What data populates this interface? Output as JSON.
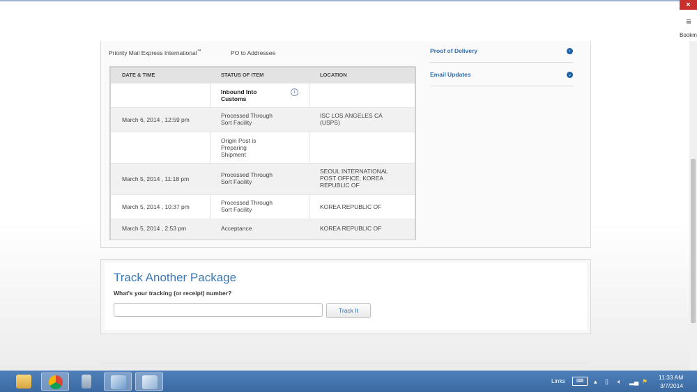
{
  "browser": {
    "close_label": "×",
    "menu_label": "≡",
    "bookmarks_label": "Bookmarks"
  },
  "shipment": {
    "service": "Priority Mail Express International",
    "service_mark": "™",
    "delivery_option": "PO to Addressee"
  },
  "table": {
    "headers": [
      "DATE & TIME",
      "STATUS OF ITEM",
      "LOCATION"
    ],
    "rows": [
      {
        "date": "",
        "status_line1": "Inbound Into",
        "status_line2": "Customs",
        "status_line3": "",
        "location_line1": "",
        "location_line2": "",
        "location_line3": ""
      },
      {
        "date": "March 6, 2014 , 12:59 pm",
        "status_line1": "Processed Through",
        "status_line2": "Sort Facility",
        "status_line3": "",
        "location_line1": "ISC LOS ANGELES CA",
        "location_line2": "(USPS)",
        "location_line3": ""
      },
      {
        "date": "",
        "status_line1": "Origin Post is",
        "status_line2": "Preparing",
        "status_line3": "Shipment",
        "location_line1": "",
        "location_line2": "",
        "location_line3": ""
      },
      {
        "date": "March 5, 2014 , 11:18 pm",
        "status_line1": "Processed Through",
        "status_line2": "Sort Facility",
        "status_line3": "",
        "location_line1": "SEOUL INTERNATIONAL",
        "location_line2": "POST OFFICE, KOREA",
        "location_line3": "REPUBLIC OF"
      },
      {
        "date": "March 5, 2014 , 10:37 pm",
        "status_line1": "Processed Through",
        "status_line2": "Sort Facility",
        "status_line3": "",
        "location_line1": "KOREA REPUBLIC OF",
        "location_line2": "",
        "location_line3": ""
      },
      {
        "date": "March 5, 2014 , 2:53 pm",
        "status_line1": "Acceptance",
        "status_line2": "",
        "status_line3": "",
        "location_line1": "KOREA REPUBLIC OF",
        "location_line2": "",
        "location_line3": ""
      }
    ],
    "info_icon_glyph": "i"
  },
  "sidebar": {
    "links": [
      {
        "label": "Proof of Delivery",
        "icon": "chevron-right-circle-icon",
        "glyph": "›"
      },
      {
        "label": "Email Updates",
        "icon": "chevron-down-circle-icon",
        "glyph": "⌄"
      }
    ]
  },
  "track": {
    "title": "Track Another Package",
    "question": "What's your tracking (or receipt) number?",
    "input_value": "",
    "button_label": "Track It"
  },
  "taskbar": {
    "apps": [
      "file-explorer-icon",
      "chrome-icon",
      "calculator-icon",
      "network-tool-icon",
      "notepad-icon"
    ],
    "links_label": "Links",
    "time": "11:33 AM",
    "date": "3/7/2014",
    "accent": "#3b6aa3"
  }
}
